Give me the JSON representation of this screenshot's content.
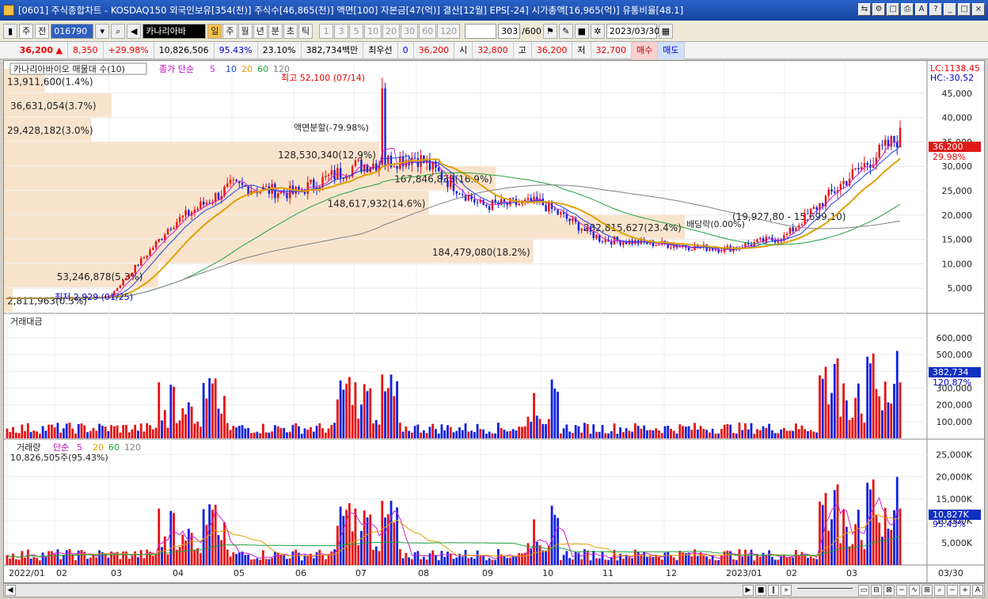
{
  "window": {
    "title": "[0601] 주식종합차트 - KOSDAQ150 외국인보유[354(천)] 주식수[46,865(천)] 액면[100] 자본금[47(억)] 결산[12월] EPS[-24] 시가총액[16,965(억)] 유통비율[48.1]"
  },
  "toolbar": {
    "market": "주",
    "prefix": "전",
    "code": "016790",
    "stock_name": "카나리아바",
    "periods": [
      "일",
      "주",
      "월",
      "년",
      "분",
      "초",
      "틱"
    ],
    "intervals": [
      "1",
      "3",
      "5",
      "10",
      "20",
      "30",
      "60",
      "120"
    ],
    "count": "303",
    "count_total": "/600",
    "date": "2023/03/30"
  },
  "quote": {
    "price": "36,200",
    "change": "8,350",
    "change_pct": "+29.98%",
    "volume": "10,826,506",
    "vol_ratio": "95.43%",
    "turnover": "23.10%",
    "amount": "382,734백만",
    "best": "최우선",
    "best_val": "0",
    "best_price": "36,200",
    "open_label": "시",
    "open": "32,800",
    "high_label": "고",
    "high": "36,200",
    "low_label": "저",
    "low": "32,700",
    "buy": "매수",
    "sell": "매도"
  },
  "price_panel": {
    "title": "카나리아바이오 매물대 수(10)",
    "ma_label": "종가 단순",
    "ma": [
      "5",
      "10",
      "20",
      "60",
      "120"
    ],
    "lc": "LC:1138.45",
    "hc": "HC:-30.52",
    "high_ann": "최고 52,100 (07/14)",
    "low_ann": "최저 2,929 (01/25)",
    "split_ann": "액면분할(-79.98%)",
    "div_ann": "배당락(0.00%)",
    "cur_price": "36,200",
    "cur_pct": "29.98%",
    "y_ticks": [
      "45,000",
      "40,000",
      "35,000",
      "30,000",
      "25,000",
      "20,000",
      "15,000",
      "10,000",
      "5,000"
    ],
    "profile": [
      {
        "label": "2,811,963(0.3%)",
        "pct": 0.3
      },
      {
        "label": "53,246,878(5.3%)",
        "pct": 5.3
      },
      {
        "label": "184,479,080(18.2%)",
        "pct": 18.2
      },
      {
        "label": "232,815,627(23.4%)",
        "pct": 23.4
      },
      {
        "label": "148,617,932(14.6%)",
        "pct": 14.6
      },
      {
        "label": "167,846,833(16.9%)",
        "pct": 16.9
      },
      {
        "label": "128,530,340(12.9%)",
        "pct": 12.9
      },
      {
        "label": "29,428,182(3.0%)",
        "pct": 3.0
      },
      {
        "label": "36,631,054(3.7%)",
        "pct": 3.7
      },
      {
        "label": "13,911,600(1.4%)",
        "pct": 1.4
      }
    ],
    "profile_extra": "(19,927,80 - 15,699,10)"
  },
  "amount_panel": {
    "title": "거래대금",
    "y_ticks": [
      "600,000",
      "500,000",
      "400,000",
      "300,000",
      "200,000",
      "100,000"
    ],
    "cur": "382,734",
    "cur_pct": "120.87%"
  },
  "volume_panel": {
    "title": "거래량",
    "ma_label": "단순",
    "ma": [
      "5",
      "20",
      "60",
      "120"
    ],
    "current": "10,826,505주(95.43%)",
    "y_ticks": [
      "25,000K",
      "20,000K",
      "15,000K",
      "10,000K",
      "5,000K"
    ],
    "cur": "10,827K",
    "cur_pct": "95.43%"
  },
  "xaxis": [
    "2022/01",
    "02",
    "03",
    "04",
    "05",
    "06",
    "07",
    "08",
    "09",
    "10",
    "11",
    "12",
    "2023/01",
    "02",
    "03"
  ],
  "xaxis_end": "03/30",
  "colors": {
    "up": "#e81010",
    "down": "#1020e0",
    "ma5": "#d020d0",
    "ma10": "#2040e0",
    "ma20": "#e0a000",
    "ma60": "#20a040",
    "ma120": "#808080",
    "profile": "#f8e4cc"
  },
  "chart_data": [
    {
      "type": "candlestick",
      "title": "카나리아바이오 매물대 수(10)",
      "y_unit": "KRW",
      "ylim": [
        0,
        52100
      ],
      "x": [
        "2022/01",
        "02",
        "03",
        "04",
        "05",
        "06",
        "07",
        "08",
        "09",
        "10",
        "11",
        "12",
        "2023/01",
        "02",
        "03",
        "03/30"
      ],
      "close": [
        2950,
        2950,
        3300,
        18000,
        26000,
        24500,
        30000,
        32000,
        22000,
        22500,
        15000,
        14000,
        13000,
        15500,
        27000,
        36200
      ],
      "high": [
        52100
      ],
      "low": [
        2929
      ]
    },
    {
      "type": "bar",
      "title": "거래대금",
      "unit": "백만",
      "current": 382734
    },
    {
      "type": "bar",
      "title": "거래량",
      "current": 10826505
    }
  ]
}
